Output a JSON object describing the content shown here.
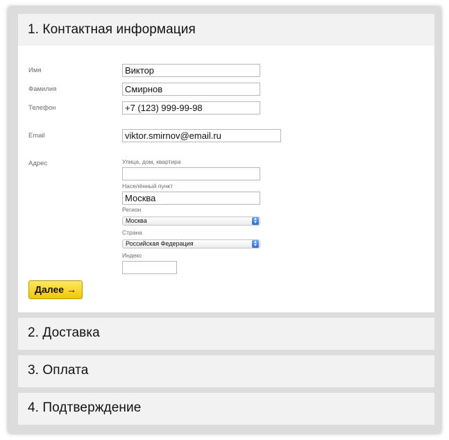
{
  "sections": [
    {
      "title": "1. Контактная информация"
    },
    {
      "title": "2. Доставка"
    },
    {
      "title": "3. Оплата"
    },
    {
      "title": "4. Подтверждение"
    }
  ],
  "form": {
    "first_name": {
      "label": "Имя",
      "value": "Виктор"
    },
    "last_name": {
      "label": "Фамилия",
      "value": "Смирнов"
    },
    "phone": {
      "label": "Телефон",
      "value": "+7 (123) 999-99-98"
    },
    "email": {
      "label": "Email",
      "value": "viktor.smirnov@email.ru"
    },
    "address": {
      "label": "Адрес",
      "street": {
        "label": "Улица, дом, квартира",
        "value": ""
      },
      "city": {
        "label": "Населённый пункт",
        "value": "Москва"
      },
      "region": {
        "label": "Регион",
        "selected": "Москва"
      },
      "country": {
        "label": "Страна",
        "selected": "Российская Федерация"
      },
      "zip": {
        "label": "Индекс",
        "value": ""
      }
    },
    "next_button": "Далее →"
  }
}
